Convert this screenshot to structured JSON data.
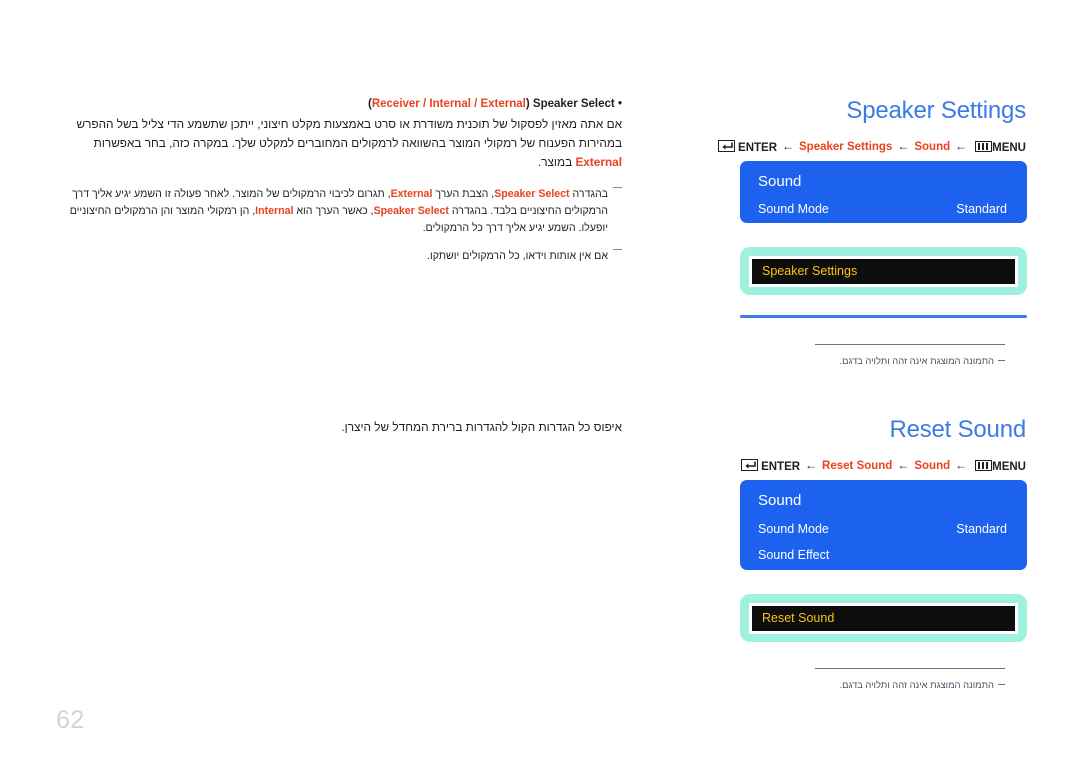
{
  "page": {
    "number": "62",
    "language": "he"
  },
  "left_column": {
    "bullet": {
      "marker": "•",
      "label": "Speaker Select",
      "options_open": "(",
      "options": "Receiver / Internal / External",
      "options_close": ")"
    },
    "paragraph": "אם אתה מאזין לפסקול של תוכנית משודרת או סרט באמצעות מקלט חיצוני, ייתכן שתשמע הדי צליל בשל ההפרש במהירות הפענוח של רמקולי המוצר בהשוואה לרמקולים המחוברים למקלט שלך. במקרה כזה, בחר באפשרות External במוצר.",
    "paragraph_highlight": "External",
    "notes": [
      "בהגדרה Speaker Select, הצבת הערך External, תגרום לכיבוי הרמקולים של המוצר. לאחר פעולה זו השמע יגיע אליך דרך הרמקולים החיצוניים בלבד. בהגדרה Speaker Select, כאשר הערך הוא Internal, הן רמקולי המוצר והן הרמקולים החיצוניים יופעלו. השמע יגיע אליך דרך כל הרמקולים.",
      "אם אין אותות וידאו, כל הרמקולים יושתקו."
    ],
    "note_highlights": [
      "Speaker Select",
      "External",
      "Internal"
    ],
    "reset_description": "איפוס כל הגדרות הקול להגדרות ברירת המחדל של היצרן."
  },
  "sections": [
    {
      "title": "Speaker Settings",
      "menu_path": {
        "menu_label": "MENU",
        "menu_icon": "menu-grid-icon",
        "crumb_1": "Sound",
        "crumb_2": "Speaker Settings",
        "enter_label": "ENTER",
        "enter_icon": "enter-return-icon",
        "arrow": "←"
      },
      "osd": {
        "title": "Sound",
        "rows": [
          {
            "label": "Sound Mode",
            "value": "Standard"
          }
        ]
      },
      "highlight_row": "Speaker Settings",
      "footer_note": "התמונה המוצגת אינה זהה ותלויה בדגם."
    },
    {
      "title": "Reset Sound",
      "menu_path": {
        "menu_label": "MENU",
        "menu_icon": "menu-grid-icon",
        "crumb_1": "Sound",
        "crumb_2": "Reset Sound",
        "enter_label": "ENTER",
        "enter_icon": "enter-return-icon",
        "arrow": "←"
      },
      "osd": {
        "title": "Sound",
        "rows": [
          {
            "label": "Sound Mode",
            "value": "Standard"
          },
          {
            "label": "Sound Effect",
            "value": ""
          }
        ]
      },
      "highlight_row": "Reset Sound",
      "footer_note": "התמונה המוצגת אינה זהה ותלויה בדגם."
    }
  ],
  "colors": {
    "heading_blue": "#3d7ae8",
    "osd_blue": "#1d62ef",
    "accent_red": "#e8431f",
    "highlight_mint": "#9ff0dd",
    "highlight_yellow": "#f5c518",
    "page_number_gray": "#d3d3d3"
  }
}
